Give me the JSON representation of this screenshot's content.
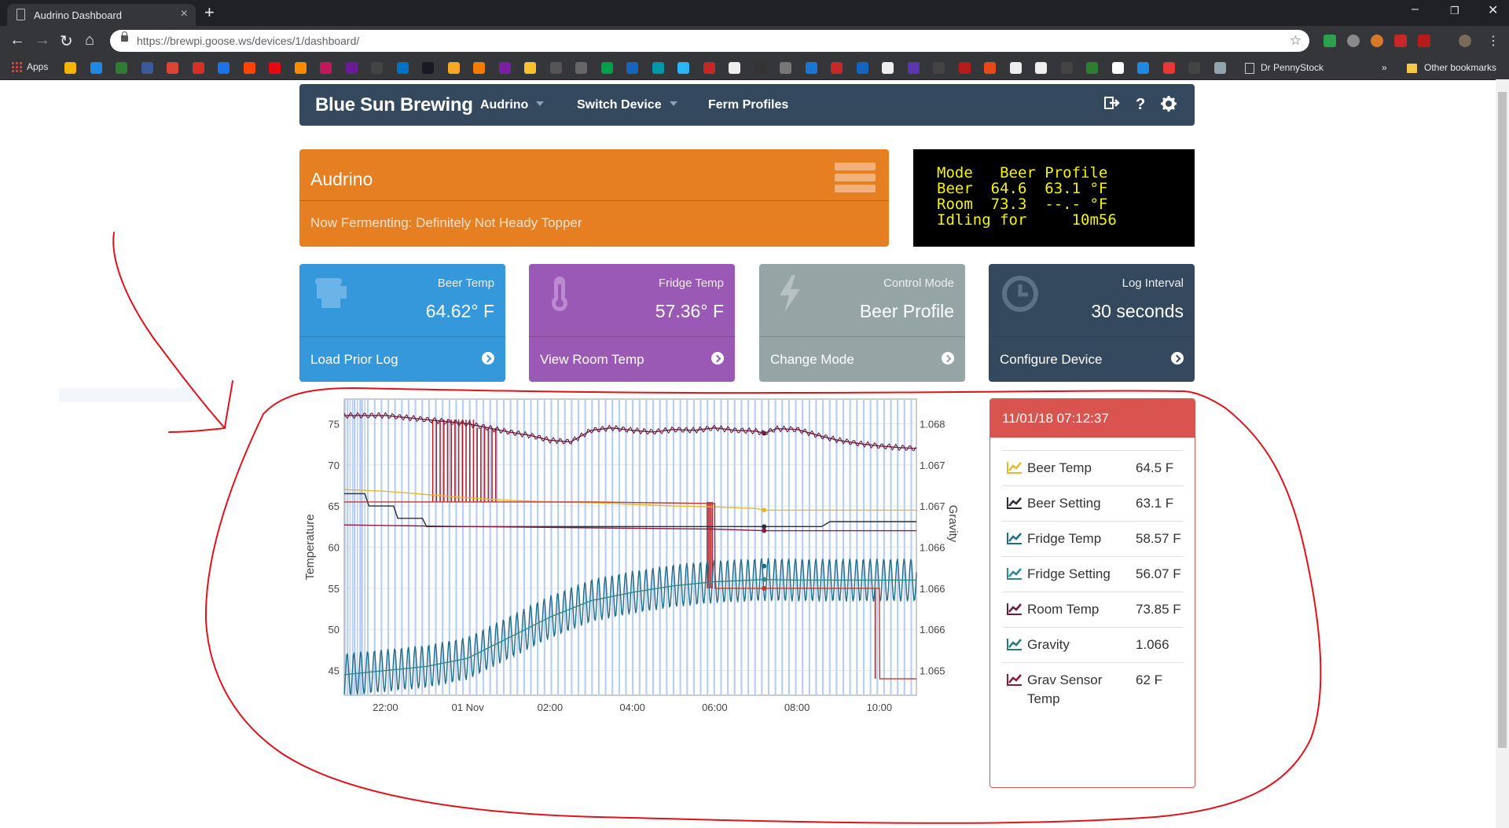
{
  "browser": {
    "tab_title": "Audrino Dashboard",
    "url": "https://brewpi.goose.ws/devices/1/dashboard/",
    "bookmarks": {
      "apps_label": "Apps",
      "pennystock": "Dr PennyStock",
      "more": "»",
      "other": "Other bookmarks"
    }
  },
  "nav": {
    "brand": "Blue Sun Brewing",
    "items": [
      {
        "label": "Audrino",
        "dropdown": true
      },
      {
        "label": "Switch Device",
        "dropdown": true
      },
      {
        "label": "Ferm Profiles",
        "dropdown": false
      }
    ],
    "icons": [
      "logout-icon",
      "help-icon",
      "settings-icon"
    ]
  },
  "device": {
    "name": "Audrino",
    "fermenting": "Now Fermenting: Definitely Not Heady Topper"
  },
  "lcd": {
    "lines": [
      "Mode   Beer Profile",
      "Beer  64.6  63.1 °F",
      "Room  73.3  --.- °F",
      "Idling for     10m56"
    ]
  },
  "cards": [
    {
      "label": "Beer Temp",
      "value": "64.62° F",
      "action": "Load Prior Log",
      "color": "#3498db",
      "icon": "mug-icon"
    },
    {
      "label": "Fridge Temp",
      "value": "57.36° F",
      "action": "View Room Temp",
      "color": "#9b59b6",
      "icon": "thermometer-icon"
    },
    {
      "label": "Control Mode",
      "value": "Beer Profile",
      "action": "Change Mode",
      "color": "#95a5a6",
      "icon": "bolt-icon"
    },
    {
      "label": "Log Interval",
      "value": "30 seconds",
      "action": "Configure Device",
      "color": "#34495e",
      "icon": "clock-icon"
    }
  ],
  "status": {
    "timestamp": "11/01/18 07:12:37",
    "rows": [
      {
        "name": "Beer Temp",
        "value": "64.5 F",
        "color": "#e5b82a"
      },
      {
        "name": "Beer Setting",
        "value": "63.1 F",
        "color": "#2c2c3a"
      },
      {
        "name": "Fridge Temp",
        "value": "58.57 F",
        "color": "#1f6d8c"
      },
      {
        "name": "Fridge Setting",
        "value": "56.07 F",
        "color": "#2d8a8a"
      },
      {
        "name": "Room Temp",
        "value": "73.85 F",
        "color": "#6b1d3e"
      },
      {
        "name": "Gravity",
        "value": "1.066",
        "color": "#2a7a7a"
      },
      {
        "name": "Grav Sensor Temp",
        "value": "62 F",
        "color": "#8a1a40"
      }
    ]
  },
  "chart_data": {
    "type": "line",
    "ylabel": "Temperature",
    "y2label": "Gravity",
    "ylim": [
      42,
      78
    ],
    "y_ticks": [
      "75",
      "70",
      "65",
      "60",
      "55",
      "50",
      "45"
    ],
    "y2_ticks": [
      "1.068",
      "1.067",
      "1.067",
      "1.066",
      "1.066",
      "1.066",
      "1.065"
    ],
    "x_ticks": [
      "22:00",
      "01 Nov",
      "02:00",
      "04:00",
      "06:00",
      "08:00",
      "10:00"
    ],
    "x_tick_hours": [
      -2,
      0,
      2,
      4,
      6,
      8,
      10
    ],
    "xlim_hours": [
      -3,
      10.9
    ],
    "highlight_time": 7.2,
    "series": [
      {
        "name": "Room Temp",
        "color": "#6b1d3e",
        "x": [
          -3,
          -2,
          -1,
          0,
          0.5,
          1,
          1.5,
          2,
          2.5,
          3,
          3.5,
          4,
          4.5,
          5,
          5.5,
          6,
          6.5,
          7,
          7.2,
          7.5,
          8,
          8.5,
          9,
          9.5,
          10,
          10.5,
          10.9
        ],
        "y": [
          76,
          76,
          75.5,
          75,
          74.5,
          74,
          73.6,
          73,
          72.8,
          74.2,
          74.5,
          74.2,
          74,
          74.3,
          74.2,
          74.5,
          74.2,
          74.1,
          73.85,
          74.4,
          74.3,
          73.6,
          73,
          72.6,
          72.3,
          72.1,
          72
        ]
      },
      {
        "name": "Beer Temp",
        "color": "#e5b82a",
        "x": [
          -3,
          -2,
          -1,
          0,
          1,
          2,
          3,
          4,
          5,
          6,
          7,
          7.2,
          8,
          9,
          10,
          10.9
        ],
        "y": [
          67,
          66.8,
          66.4,
          66,
          65.7,
          65.5,
          65.4,
          65.2,
          65,
          64.9,
          64.7,
          64.5,
          64.5,
          64.5,
          64.5,
          64.5
        ]
      },
      {
        "name": "Beer Setting",
        "color": "#2c2c3a",
        "x": [
          -3,
          -2.5,
          -2.4,
          -1.8,
          -1.7,
          -1.1,
          -1,
          7.2,
          8.6,
          8.8,
          10.9
        ],
        "y": [
          66.5,
          66.5,
          65,
          65,
          63.5,
          63.5,
          62.5,
          62.5,
          62.5,
          63.1,
          63.1
        ]
      },
      {
        "name": "Fridge Setting",
        "color": "#2d8a8a",
        "x": [
          -3,
          -2,
          -1,
          0,
          1,
          2,
          3,
          4,
          5,
          6,
          7.2,
          8,
          9,
          10,
          10.9
        ],
        "y": [
          44.5,
          45,
          45.5,
          46.5,
          49,
          51.5,
          53.5,
          54.5,
          55.3,
          55.8,
          56.07,
          56,
          56,
          56,
          56
        ]
      },
      {
        "name": "Gravity",
        "color": "#c0392b",
        "x": [
          -3,
          0,
          3,
          6,
          6.01,
          7.2,
          8.5,
          10,
          10.01,
          10.9
        ],
        "y": [
          65.5,
          65.5,
          65.5,
          65.3,
          55,
          55,
          55,
          55,
          44,
          44
        ]
      },
      {
        "name": "Grav Sensor Temp",
        "color": "#8a1a40",
        "x": [
          -3,
          0,
          6,
          7.2,
          10.9
        ],
        "y": [
          62.7,
          62.5,
          62.2,
          62,
          62
        ]
      }
    ],
    "fridge_temp_oscillation": {
      "name": "Fridge Temp",
      "color": "#1f6d8c",
      "amplitude": 2.6
    }
  }
}
